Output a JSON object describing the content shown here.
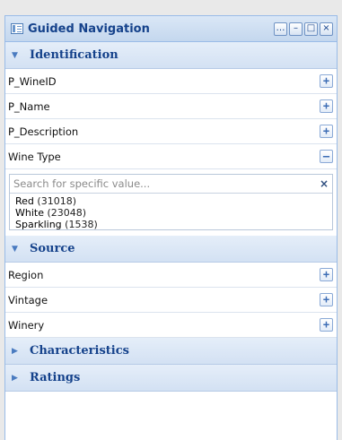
{
  "panel": {
    "title": "Guided Navigation",
    "tools": [
      "…",
      "–",
      "□",
      "×"
    ]
  },
  "sections": {
    "identification": {
      "label": "Identification",
      "rows": [
        {
          "label": "P_WineID",
          "toggle": "+"
        },
        {
          "label": "P_Name",
          "toggle": "+"
        },
        {
          "label": "P_Description",
          "toggle": "+"
        },
        {
          "label": "Wine Type",
          "toggle": "–"
        }
      ],
      "value_search": {
        "placeholder": "Search for specific value...",
        "clear": "×",
        "values": [
          {
            "name": "Red",
            "count": "(31018)"
          },
          {
            "name": "White",
            "count": "(23048)"
          },
          {
            "name": "Sparkling",
            "count": "(1538)"
          }
        ]
      }
    },
    "source": {
      "label": "Source",
      "rows": [
        {
          "label": "Region",
          "toggle": "+"
        },
        {
          "label": "Vintage",
          "toggle": "+"
        },
        {
          "label": "Winery",
          "toggle": "+"
        }
      ]
    },
    "characteristics": {
      "label": "Characteristics"
    },
    "ratings": {
      "label": "Ratings"
    }
  },
  "glyphs": {
    "expanded": "▼",
    "collapsed": "▶"
  },
  "colors": {
    "accent": "#15428b",
    "header_bg": "#d3e1f3",
    "border": "#99bbe8"
  }
}
